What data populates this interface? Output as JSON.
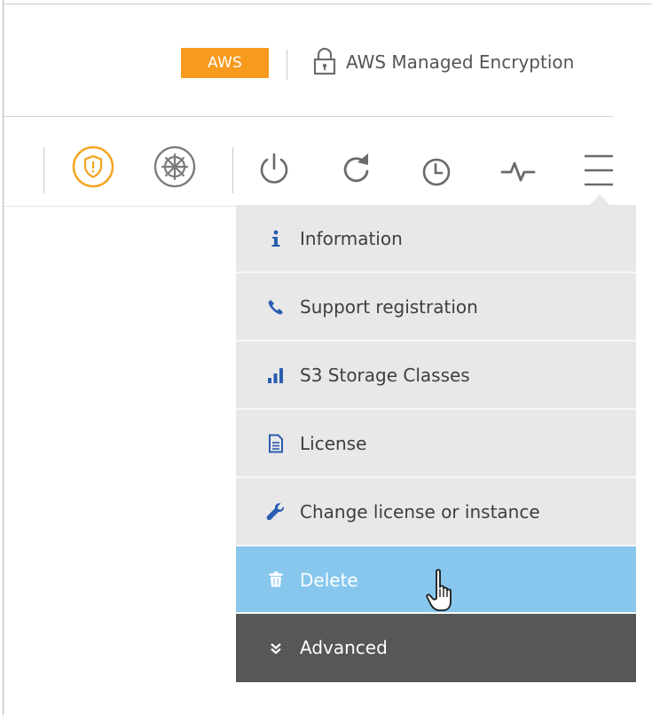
{
  "header": {
    "provider_badge": "AWS",
    "encryption_label": "AWS Managed Encryption",
    "lock_icon": "lock-icon"
  },
  "toolbar": {
    "icons": [
      "shield-alert-icon",
      "kubernetes-wheel-icon",
      "power-icon",
      "refresh-icon",
      "clock-icon",
      "activity-pulse-icon",
      "hamburger-menu-icon"
    ]
  },
  "menu": {
    "items": [
      {
        "label": "Information",
        "icon": "info-icon"
      },
      {
        "label": "Support registration",
        "icon": "phone-icon"
      },
      {
        "label": "S3 Storage Classes",
        "icon": "bar-chart-icon"
      },
      {
        "label": "License",
        "icon": "document-icon"
      },
      {
        "label": "Change license or instance",
        "icon": "wrench-icon"
      },
      {
        "label": "Delete",
        "icon": "trash-icon",
        "state": "hovered"
      },
      {
        "label": "Advanced",
        "icon": "double-chevron-down-icon"
      }
    ]
  },
  "colors": {
    "aws_badge": "#f79a1e",
    "shield_accent": "#f5a623",
    "menu_background": "#e8e8e8",
    "menu_icon_blue": "#2a5db0",
    "delete_hover": "#87c7ee",
    "advanced_background": "#575757"
  }
}
